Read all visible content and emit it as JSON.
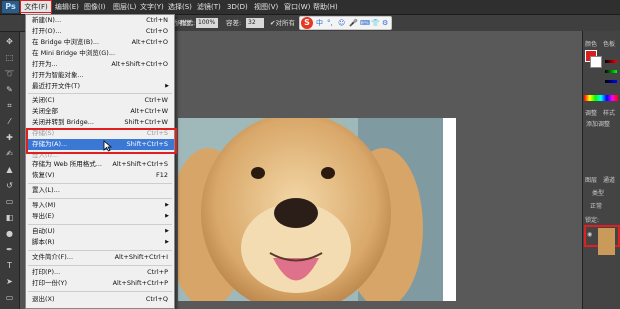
{
  "app": {
    "logo": "Ps"
  },
  "menubar": {
    "items": [
      "文件(F)",
      "编辑(E)",
      "图像(I)",
      "图层(L)",
      "文字(Y)",
      "选择(S)",
      "滤镜(T)",
      "3D(D)",
      "视图(V)",
      "窗口(W)",
      "帮助(H)"
    ]
  },
  "options": {
    "style_label": "样式:",
    "style_value": "正常",
    "opacity_label": "不透明度:",
    "opacity_value": "100%",
    "flow_label": "容差:",
    "flow_value": "32",
    "sample_label": "✔对所有",
    "ime_icons": [
      "中",
      "°,",
      "☺",
      "🎤",
      "⌨",
      "👕",
      "⚙"
    ]
  },
  "file_menu": {
    "items": [
      {
        "label": "新建(N)...",
        "shortcut": "Ctrl+N"
      },
      {
        "label": "打开(O)...",
        "shortcut": "Ctrl+O"
      },
      {
        "label": "在 Bridge 中浏览(B)...",
        "shortcut": "Alt+Ctrl+O"
      },
      {
        "label": "在 Mini Bridge 中浏览(G)...",
        "shortcut": ""
      },
      {
        "label": "打开为...",
        "shortcut": "Alt+Shift+Ctrl+O"
      },
      {
        "label": "打开为智能对象...",
        "shortcut": ""
      },
      {
        "label": "最近打开文件(T)",
        "shortcut": ""
      },
      {
        "label": "关闭(C)",
        "shortcut": "Ctrl+W"
      },
      {
        "label": "关闭全部",
        "shortcut": "Alt+Ctrl+W"
      },
      {
        "label": "关闭并转到 Bridge...",
        "shortcut": "Shift+Ctrl+W"
      },
      {
        "label": "存储(S)",
        "shortcut": "Ctrl+S"
      },
      {
        "label": "存储为(A)...",
        "shortcut": "Shift+Ctrl+S"
      },
      {
        "label": "签入(I)...",
        "shortcut": ""
      },
      {
        "label": "存储为 Web 所用格式...",
        "shortcut": "Alt+Shift+Ctrl+S"
      },
      {
        "label": "恢复(V)",
        "shortcut": "F12"
      },
      {
        "label": "置入(L)...",
        "shortcut": ""
      },
      {
        "label": "导入(M)",
        "shortcut": ""
      },
      {
        "label": "导出(E)",
        "shortcut": ""
      },
      {
        "label": "自动(U)",
        "shortcut": ""
      },
      {
        "label": "脚本(R)",
        "shortcut": ""
      },
      {
        "label": "文件简介(F)...",
        "shortcut": "Alt+Shift+Ctrl+I"
      },
      {
        "label": "打印(P)...",
        "shortcut": "Ctrl+P"
      },
      {
        "label": "打印一份(Y)",
        "shortcut": "Alt+Shift+Ctrl+P"
      },
      {
        "label": "退出(X)",
        "shortcut": "Ctrl+Q"
      }
    ]
  },
  "panels": {
    "color_tab": "颜色",
    "swatches_tab": "色板",
    "adjust_tab": "调整",
    "style_tab": "样式",
    "add_adjust": "添加调整",
    "layers_tab": "图层",
    "channels_tab": "通道",
    "kind": "类型",
    "blend": "正常",
    "lock": "锁定:"
  },
  "colors": {
    "highlight": "#3a78d4",
    "annotation_red": "#e02020"
  }
}
